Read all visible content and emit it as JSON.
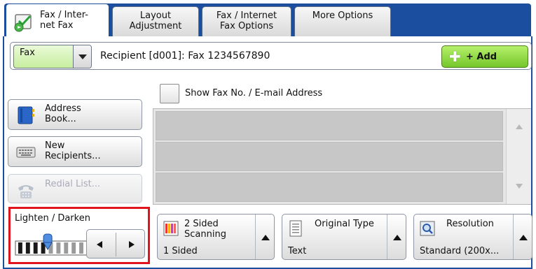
{
  "tabs": [
    {
      "label_line1": "Fax / Inter-",
      "label_line2": "net Fax",
      "active": true
    },
    {
      "label_line1": "Layout",
      "label_line2": "Adjustment",
      "active": false
    },
    {
      "label_line1": "Fax / Internet",
      "label_line2": "Fax Options",
      "active": false
    },
    {
      "label_line1": "More Options",
      "label_line2": "",
      "active": false
    }
  ],
  "recipient_bar": {
    "mode_value": "Fax",
    "recipient_text": "Recipient [d001]: Fax  1234567890",
    "add_label": "+ Add"
  },
  "show_fax_label": "Show Fax No. / E-mail Address",
  "side_buttons": {
    "address_book_line1": "Address",
    "address_book_line2": "Book...",
    "new_recipients_line1": "New",
    "new_recipients_line2": "Recipients...",
    "redial_list": "Redial List..."
  },
  "lighten_darken": {
    "title": "Lighten / Darken",
    "level_fraction": 0.45
  },
  "features": {
    "two_sided": {
      "title_line1": "2 Sided",
      "title_line2": "Scanning",
      "value": "1 Sided"
    },
    "original_type": {
      "title": "Original Type",
      "value": "Text"
    },
    "resolution": {
      "title": "Resolution",
      "value": "Standard (200x..."
    }
  },
  "colors": {
    "tab_blue": "#1c4ea0",
    "highlight_red": "#e0141c",
    "add_green": "#74c72b",
    "select_green": "#c7ee9f"
  }
}
